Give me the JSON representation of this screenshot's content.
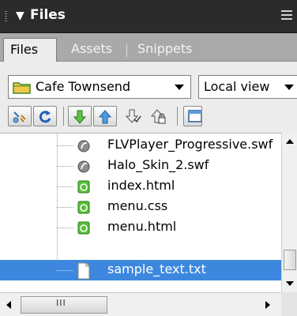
{
  "panel": {
    "title": "Files",
    "collapse_glyph": "▼"
  },
  "tabs": [
    {
      "label": "Files",
      "active": true
    },
    {
      "label": "Assets",
      "active": false
    },
    {
      "label": "Snippets",
      "active": false
    }
  ],
  "toolbar": {
    "site_select": "Cafe Townsend",
    "view_select": "Local view",
    "buttons": [
      "connect-icon",
      "refresh-icon",
      "get-files-icon",
      "put-files-icon",
      "check-out-icon",
      "check-in-icon",
      "expand-icon"
    ]
  },
  "files": [
    {
      "name": "FLVPlayer_Progressive.swf",
      "type": "swf",
      "selected": false
    },
    {
      "name": "Halo_Skin_2.swf",
      "type": "swf",
      "selected": false
    },
    {
      "name": "index.html",
      "type": "html",
      "selected": false
    },
    {
      "name": "menu.css",
      "type": "css",
      "selected": false
    },
    {
      "name": "menu.html",
      "type": "html",
      "selected": false
    },
    {
      "name": "sample_text.txt",
      "type": "txt",
      "selected": true
    }
  ],
  "hscroll_grip": "III",
  "colors": {
    "titlebar": "#2b2b2b",
    "tabbar": "#a9a9a9",
    "selection": "#3d88de",
    "toolbar": "#ececec"
  }
}
